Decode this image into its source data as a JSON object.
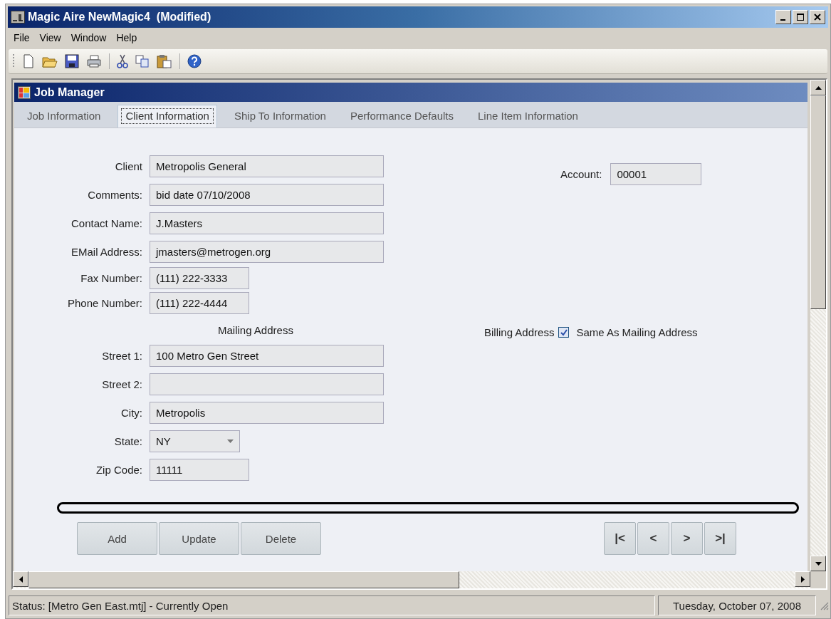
{
  "window": {
    "title": "Magic Aire NewMagic4  (Modified)"
  },
  "menu": [
    "File",
    "View",
    "Window",
    "Help"
  ],
  "child_window": {
    "title": "Job Manager"
  },
  "tabs": [
    {
      "label": "Job Information",
      "selected": false
    },
    {
      "label": "Client Information",
      "selected": true
    },
    {
      "label": "Ship To Information",
      "selected": false
    },
    {
      "label": "Performance Defaults",
      "selected": false
    },
    {
      "label": "Line Item Information",
      "selected": false
    }
  ],
  "client_fields": [
    {
      "label": "Client",
      "value": "Metropolis General",
      "kind": "wide"
    },
    {
      "label": "Comments:",
      "value": "bid date 07/10/2008",
      "kind": "wide"
    },
    {
      "label": "Contact Name:",
      "value": "J.Masters",
      "kind": "wide"
    },
    {
      "label": "EMail Address:",
      "value": "jmasters@metrogen.org",
      "kind": "wide"
    },
    {
      "label": "Fax Number:",
      "value": "(111) 222-3333",
      "kind": "short"
    },
    {
      "label": "Phone Number:",
      "value": "(111) 222-4444",
      "kind": "short"
    }
  ],
  "account": {
    "label": "Account:",
    "value": "00001"
  },
  "mailing_address": {
    "heading": "Mailing Address",
    "fields": [
      {
        "label": "Street 1:",
        "value": "100 Metro Gen Street",
        "kind": "wide"
      },
      {
        "label": "Street 2:",
        "kind": "wide"
      },
      {
        "label": "City:",
        "value": "Metropolis",
        "kind": "wide"
      },
      {
        "label": "State:",
        "value": "NY",
        "kind": "dropdown"
      },
      {
        "label": "Zip Code:",
        "value": "11111",
        "kind": "short"
      }
    ]
  },
  "billing": {
    "label": "Billing Address",
    "checkbox_label": "Same As Mailing Address",
    "checked": true
  },
  "action_buttons": [
    "Add",
    "Update",
    "Delete"
  ],
  "nav_buttons": [
    "|<",
    "<",
    ">",
    ">|"
  ],
  "status_bar": {
    "status": "Status: [Metro Gen East.mtj] - Currently Open",
    "date": "Tuesday, October 07, 2008"
  }
}
